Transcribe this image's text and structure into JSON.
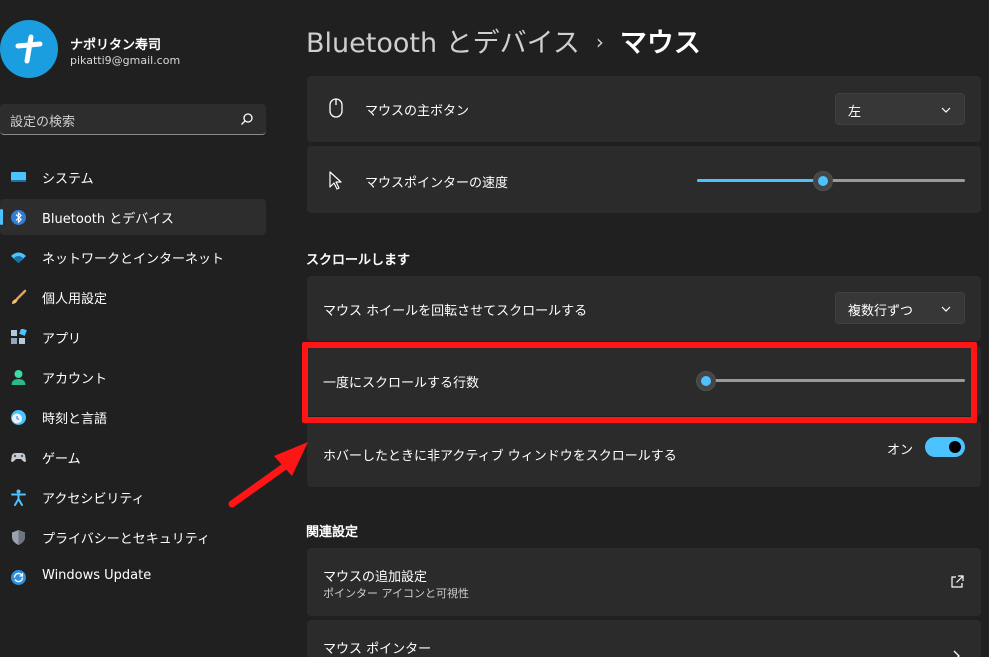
{
  "profile": {
    "name": "ナポリタン寿司",
    "email": "pikatti9@gmail.com"
  },
  "search": {
    "placeholder": "設定の検索"
  },
  "sidebar": {
    "items": [
      {
        "label": "システム",
        "icon": "system-icon"
      },
      {
        "label": "Bluetooth とデバイス",
        "icon": "bluetooth-icon",
        "active": true
      },
      {
        "label": "ネットワークとインターネット",
        "icon": "wifi-icon"
      },
      {
        "label": "個人用設定",
        "icon": "brush-icon"
      },
      {
        "label": "アプリ",
        "icon": "apps-icon"
      },
      {
        "label": "アカウント",
        "icon": "account-icon"
      },
      {
        "label": "時刻と言語",
        "icon": "time-language-icon"
      },
      {
        "label": "ゲーム",
        "icon": "gamepad-icon"
      },
      {
        "label": "アクセシビリティ",
        "icon": "accessibility-icon"
      },
      {
        "label": "プライバシーとセキュリティ",
        "icon": "shield-icon"
      },
      {
        "label": "Windows Update",
        "icon": "update-icon"
      }
    ]
  },
  "header": {
    "breadcrumb": "Bluetooth とデバイス",
    "separator": "›",
    "current": "マウス"
  },
  "settings": {
    "primary_button": {
      "label": "マウスの主ボタン",
      "value": "左"
    },
    "pointer_speed": {
      "label": "マウスポインターの速度",
      "value_fraction": 0.47
    },
    "scroll_section_title": "スクロールします",
    "wheel_scroll": {
      "label": "マウス ホイールを回転させてスクロールする",
      "value": "複数行ずつ"
    },
    "lines_to_scroll": {
      "label": "一度にスクロールする行数",
      "value_fraction": 0.0
    },
    "inactive_scroll": {
      "label": "ホバーしたときに非アクティブ ウィンドウをスクロールする",
      "state": "オン"
    },
    "related_section_title": "関連設定",
    "additional_settings": {
      "label": "マウスの追加設定",
      "sublabel": "ポインター アイコンと可視性"
    },
    "mouse_pointer": {
      "label": "マウス ポインター"
    }
  },
  "colors": {
    "accent": "#4cc2ff",
    "highlight": "#ff1515",
    "background": "#202020",
    "card": "#2b2b2b"
  }
}
